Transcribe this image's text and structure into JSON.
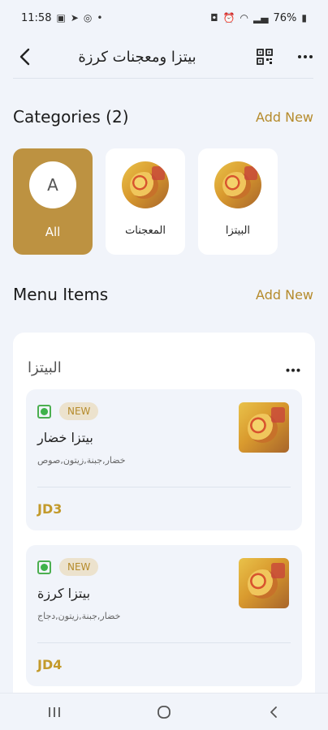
{
  "status_bar": {
    "time": "11:58",
    "battery": "76%"
  },
  "header": {
    "title": "بيتزا ومعجنات كرزة"
  },
  "categories_section": {
    "title": "Categories (2)",
    "add_new": "Add New",
    "items": [
      {
        "label": "All",
        "avatar_letter": "A",
        "active": true
      },
      {
        "label": "المعجنات",
        "active": false
      },
      {
        "label": "البيتزا",
        "active": false
      }
    ]
  },
  "menu_section": {
    "title": "Menu Items",
    "add_new": "Add New",
    "group": {
      "title": "البيتزا",
      "items": [
        {
          "badge": "NEW",
          "name": "بيتزا خضار",
          "description": "خضار,جبنة,زيتون,صوص",
          "price": "JD3"
        },
        {
          "badge": "NEW",
          "name": "بيتزا كرزة",
          "description": "خضار,جبنة,زيتون,دجاج",
          "price": "JD4"
        }
      ]
    }
  },
  "colors": {
    "accent": "#bd9241",
    "accent_text": "#b58b2c",
    "background": "#f1f4fa",
    "veg_green": "#3fb24a"
  }
}
